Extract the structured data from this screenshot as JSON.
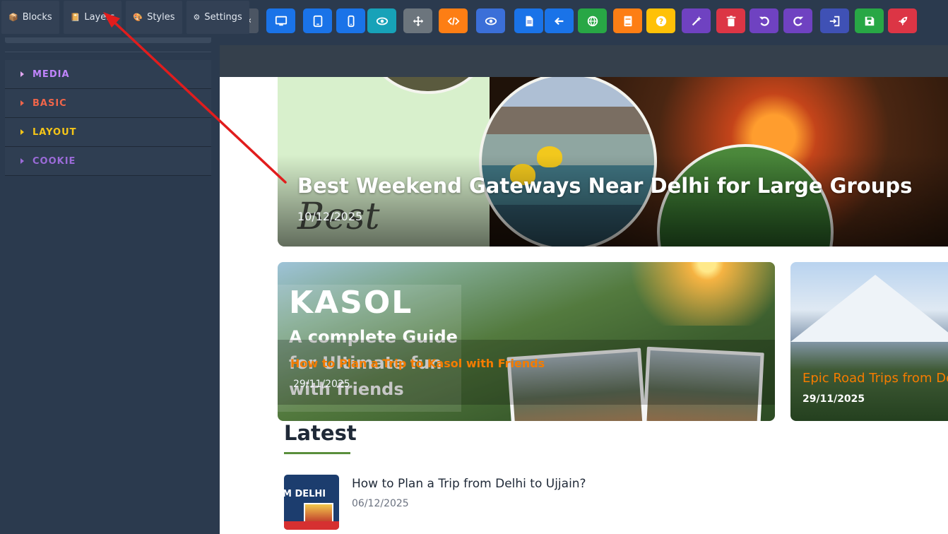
{
  "panel_tabs": [
    {
      "label": "Blocks",
      "icon": "box-icon"
    },
    {
      "label": "Layers",
      "icon": "layers-icon"
    },
    {
      "label": "Styles",
      "icon": "palette-icon"
    },
    {
      "label": "Settings",
      "icon": "gear-icon"
    }
  ],
  "categories": [
    {
      "label": "MEDIA",
      "color": "#c084fc"
    },
    {
      "label": "BASIC",
      "color": "#f0654a"
    },
    {
      "label": "LAYOUT",
      "color": "#f5c518"
    },
    {
      "label": "COOKIE",
      "color": "#9b6bd8"
    }
  ],
  "toolbar_buttons": [
    {
      "name": "desktop-view-button",
      "icon": "desktop-icon",
      "color": "#1a73e8"
    },
    {
      "name": "tablet-view-button",
      "icon": "tablet-icon",
      "color": "#1a73e8"
    },
    {
      "name": "mobile-view-button",
      "icon": "mobile-icon",
      "color": "#1a73e8"
    },
    {
      "name": "preview-button",
      "icon": "eye-icon",
      "color": "#17a2b8"
    },
    {
      "name": "move-button",
      "icon": "move-icon",
      "color": "#6c757d"
    },
    {
      "name": "code-button",
      "icon": "code-icon",
      "color": "#fd7e14"
    },
    {
      "name": "view-components-button",
      "icon": "eye-icon",
      "color": "#3b6fd8"
    },
    {
      "name": "page-button",
      "icon": "file-icon",
      "color": "#1a73e8"
    },
    {
      "name": "back-button",
      "icon": "arrow-left-icon",
      "color": "#1a73e8"
    },
    {
      "name": "globe-button",
      "icon": "globe-icon",
      "color": "#28a745"
    },
    {
      "name": "book-button",
      "icon": "book-icon",
      "color": "#fd7e14"
    },
    {
      "name": "help-button",
      "icon": "question-icon",
      "color": "#ffc107"
    },
    {
      "name": "magic-button",
      "icon": "magic-wand-icon",
      "color": "#6f42c1"
    },
    {
      "name": "delete-button",
      "icon": "trash-icon",
      "color": "#dc3545"
    },
    {
      "name": "undo-button",
      "icon": "undo-icon",
      "color": "#6f42c1"
    },
    {
      "name": "redo-button",
      "icon": "redo-icon",
      "color": "#6f42c1"
    },
    {
      "name": "import-button",
      "icon": "import-icon",
      "color": "#3f51b5"
    },
    {
      "name": "save-button",
      "icon": "save-icon",
      "color": "#28a745"
    },
    {
      "name": "publish-button",
      "icon": "rocket-icon",
      "color": "#dc3545"
    }
  ],
  "hero": {
    "title": "Best Weekend Gateways Near Delhi for Large Groups",
    "date": "10/12/2025",
    "script_text": "Best"
  },
  "card_kasol": {
    "overlay_title": "KASOL",
    "overlay_subtitle": "A complete Guide for Ultimate fun with friends",
    "title": "How to Plan a Trip to Kasol with Friends",
    "date": "29/11/2025"
  },
  "card_road": {
    "title": "Epic Road Trips from Delhi",
    "date": "29/11/2025"
  },
  "latest": {
    "heading": "Latest",
    "posts": [
      {
        "title": "How to Plan a Trip from Delhi to Ujjain?",
        "date": "06/12/2025",
        "thumb_text": "M DELHI"
      }
    ]
  },
  "colors": {
    "accent_orange": "#f57c00",
    "annotation_arrow": "#e11d1d"
  }
}
